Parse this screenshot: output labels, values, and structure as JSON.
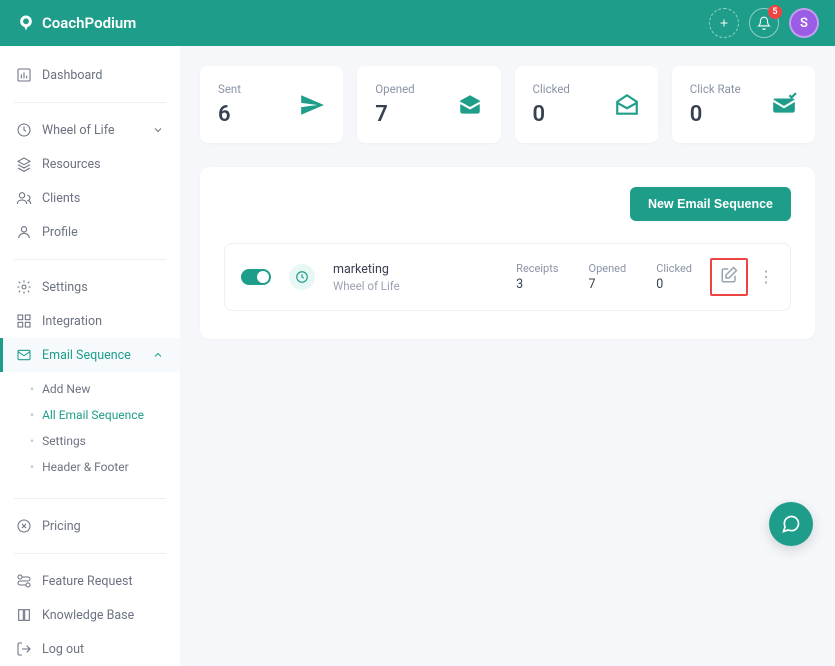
{
  "brand": "CoachPodium",
  "header": {
    "notif_count": "5",
    "avatar_initial": "S"
  },
  "sidebar": {
    "dashboard": "Dashboard",
    "wheel": "Wheel of Life",
    "resources": "Resources",
    "clients": "Clients",
    "profile": "Profile",
    "settings": "Settings",
    "integration": "Integration",
    "email_seq": "Email Sequence",
    "sub": {
      "add": "Add New",
      "all": "All Email Sequence",
      "settings": "Settings",
      "hf": "Header & Footer"
    },
    "pricing": "Pricing",
    "feature": "Feature Request",
    "kb": "Knowledge Base",
    "logout": "Log out"
  },
  "stats": {
    "sent_label": "Sent",
    "sent_value": "6",
    "opened_label": "Opened",
    "opened_value": "7",
    "clicked_label": "Clicked",
    "clicked_value": "0",
    "rate_label": "Click Rate",
    "rate_value": "0"
  },
  "panel": {
    "new_btn": "New Email Sequence",
    "row": {
      "name": "marketing",
      "type": "Wheel of Life",
      "receipts_label": "Receipts",
      "receipts_val": "3",
      "opened_label": "Opened",
      "opened_val": "7",
      "clicked_label": "Clicked",
      "clicked_val": "0"
    }
  }
}
